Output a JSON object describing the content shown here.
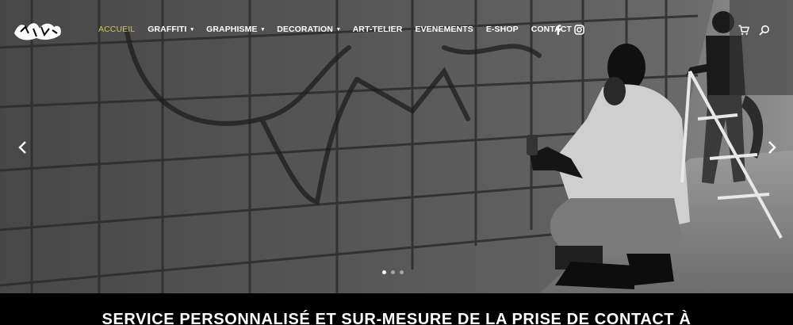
{
  "nav": {
    "items": [
      {
        "label": "ACCUEIL",
        "dropdown": false,
        "active": true
      },
      {
        "label": "GRAFFITI",
        "dropdown": true,
        "active": false
      },
      {
        "label": "GRAPHISME",
        "dropdown": true,
        "active": false
      },
      {
        "label": "DECORATION",
        "dropdown": true,
        "active": false
      },
      {
        "label": "ART-TELIER",
        "dropdown": false,
        "active": false
      },
      {
        "label": "EVENEMENTS",
        "dropdown": false,
        "active": false
      },
      {
        "label": "E-SHOP",
        "dropdown": false,
        "active": false
      },
      {
        "label": "CONTACT",
        "dropdown": false,
        "active": false
      }
    ],
    "dropdown_caret": "▾",
    "active_color": "#d3c14a"
  },
  "icons": {
    "logo": "graffiti-logo",
    "social": [
      "facebook-icon",
      "instagram-icon"
    ],
    "utility": [
      "cart-icon",
      "search-icon"
    ],
    "slider": [
      "prev-arrow-icon",
      "next-arrow-icon"
    ]
  },
  "slider": {
    "slide_count": 3,
    "active_index": 0
  },
  "banner": {
    "headline": "SERVICE PERSONNALISÉ ET SUR-MESURE DE LA PRISE DE CONTACT À"
  }
}
